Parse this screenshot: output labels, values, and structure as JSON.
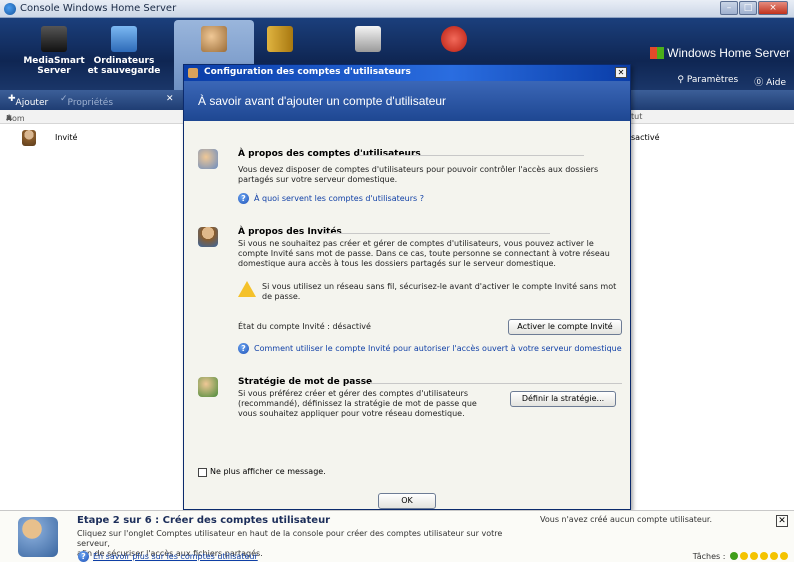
{
  "window": {
    "title": "Console Windows Home Server"
  },
  "tabs": [
    {
      "label1": "MediaSmart",
      "label2": "Server"
    },
    {
      "label1": "Ordinateurs",
      "label2": "et sauvegarde"
    }
  ],
  "header": {
    "brand": "Windows Home Server",
    "settings": "Paramètres",
    "help": "Aide"
  },
  "toolbar": {
    "add": "Ajouter",
    "properties": "Propriétés"
  },
  "list": {
    "col_name": "Nom",
    "col_status": "tut",
    "rows": [
      {
        "name": "Invité",
        "status": "sactivé"
      }
    ]
  },
  "dialog": {
    "title": "Configuration des comptes d'utilisateurs",
    "banner": "À savoir avant d'ajouter un compte d'utilisateur",
    "s1": {
      "heading": "À propos des comptes d'utilisateurs",
      "line1": "Vous devez disposer de comptes d'utilisateurs pour pouvoir contrôler l'accès aux dossiers",
      "line2": "partagés sur votre serveur domestique.",
      "link": "À quoi servent les comptes d'utilisateurs ?"
    },
    "s2": {
      "heading": "À propos des Invités",
      "line1": "Si vous ne souhaitez pas créer et gérer de comptes d'utilisateurs, vous pouvez activer le",
      "line2": "compte Invité sans mot de passe. Dans ce cas, toute personne se connectant à votre réseau",
      "line3": "domestique aura accès à tous les dossiers partagés sur le serveur domestique.",
      "warn1": "Si vous utilisez un réseau sans fil, sécurisez-le avant d'activer le compte Invité sans mot",
      "warn2": "de passe.",
      "status": "État du compte Invité : désactivé",
      "button": "Activer le compte Invité",
      "link": "Comment utiliser le compte Invité pour autoriser l'accès ouvert à votre serveur domestique"
    },
    "s3": {
      "heading": "Stratégie de mot de passe",
      "line1": "Si vous préférez créer et gérer des comptes d'utilisateurs",
      "line2": "(recommandé), définissez la stratégie de mot de passe que",
      "line3": "vous souhaitez appliquer pour votre réseau domestique.",
      "button": "Définir la stratégie..."
    },
    "checkbox": "Ne plus afficher ce message.",
    "ok": "OK"
  },
  "bottom": {
    "title": "Etape 2 sur 6 : Créer des comptes utilisateur",
    "text1": "Cliquez sur l'onglet Comptes utilisateur en haut de la console pour créer des comptes utilisateur sur votre serveur,",
    "text2": "afin de sécuriser l'accès aux fichiers partagés.",
    "link": "En savoir plus sur les comptes utilisateur",
    "status": "Vous n'avez créé aucun compte utilisateur.",
    "tasks": "Tâches :"
  }
}
